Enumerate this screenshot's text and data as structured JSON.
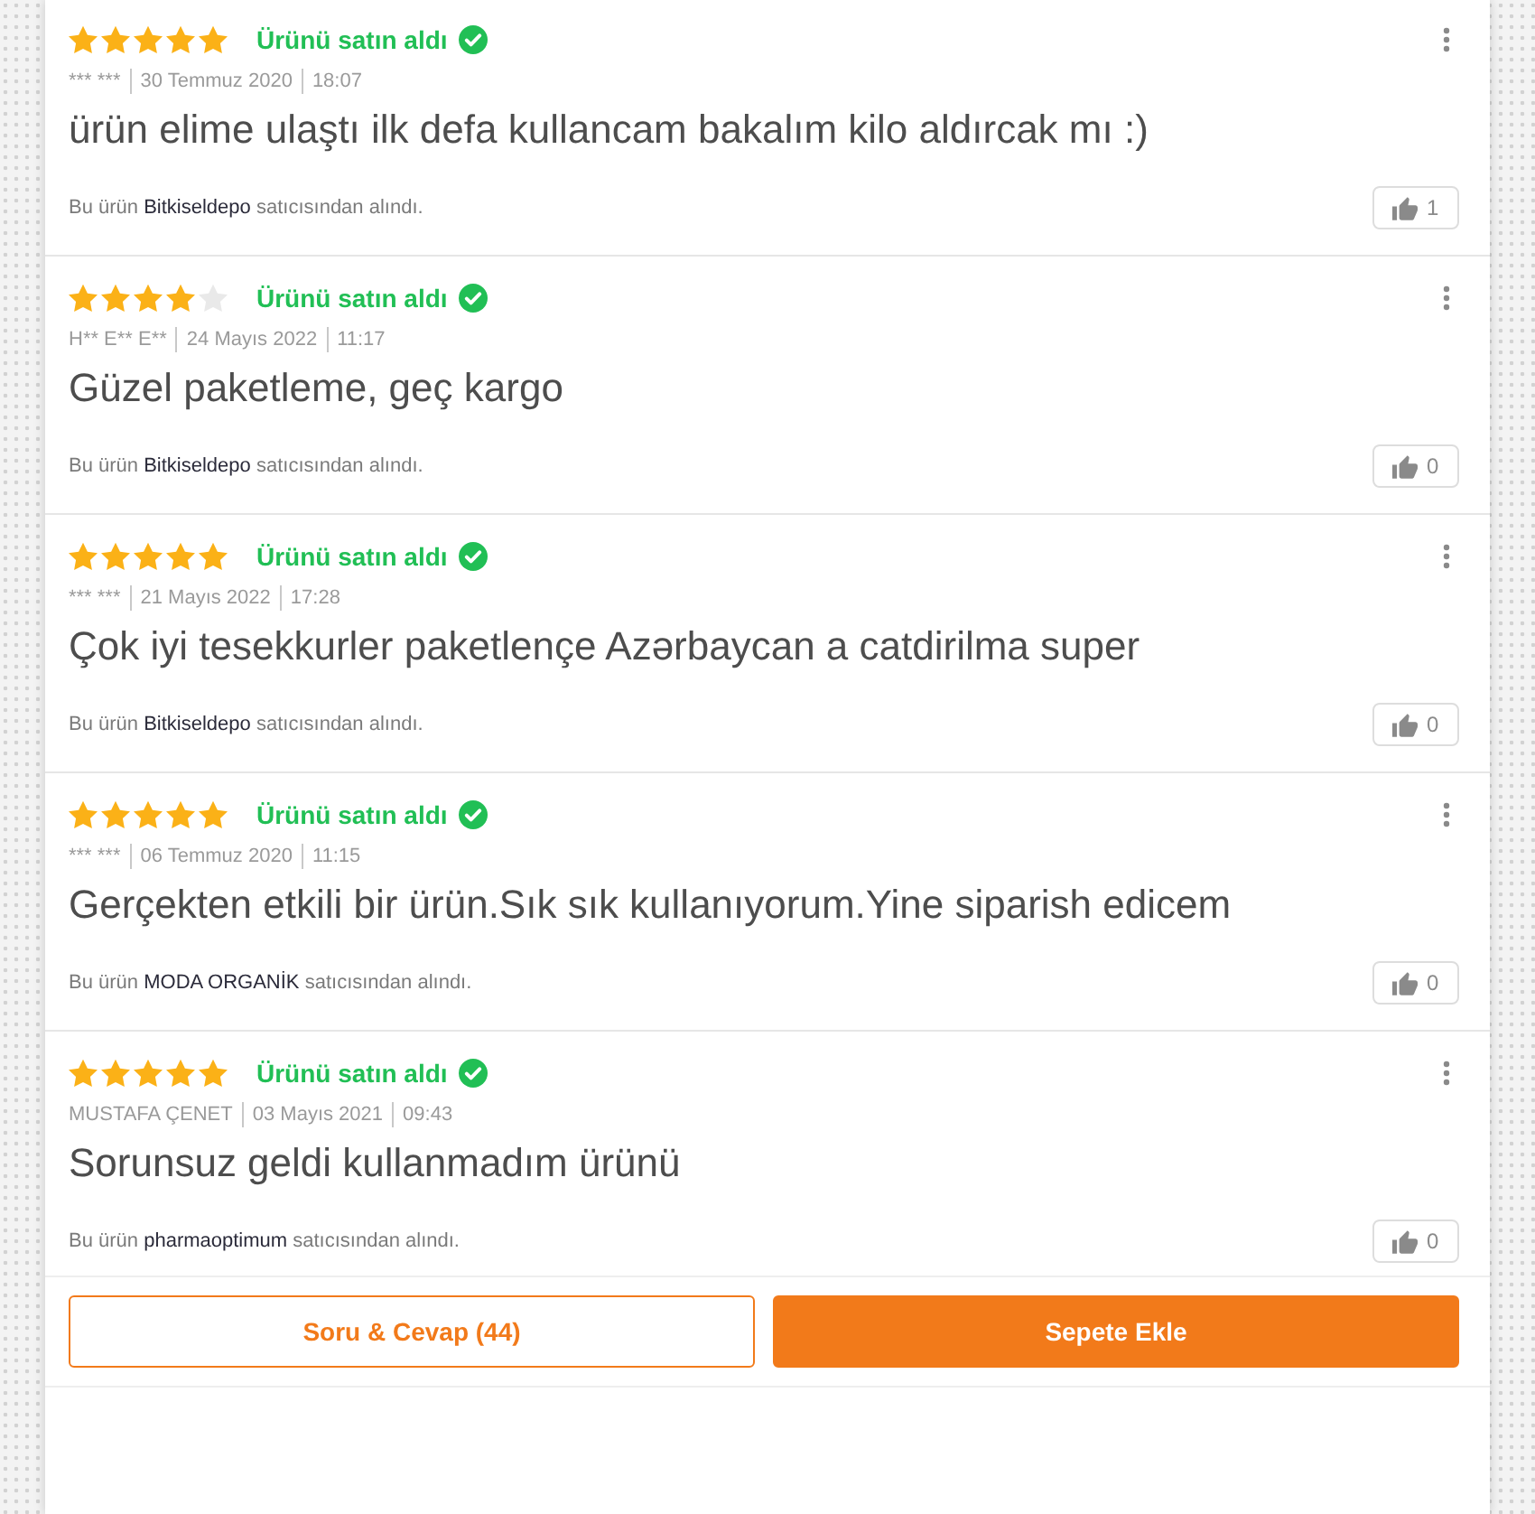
{
  "reviews": [
    {
      "stars": 5,
      "badge": "Ürünü satın aldı",
      "author": "*** ***",
      "date": "30 Temmuz 2020",
      "time": "18:07",
      "comment": "ürün elime ulaştı ilk defa kullancam bakalım kilo aldırcak mı :)",
      "seller_note": {
        "before": "Bu ürün",
        "seller": "Bitkiseldepo",
        "after": "satıcısından alındı."
      },
      "likes": "1"
    },
    {
      "stars": 4,
      "badge": "Ürünü satın aldı",
      "author": "H** E** E**",
      "date": "24 Mayıs 2022",
      "time": "11:17",
      "comment": "Güzel paketleme, geç kargo",
      "seller_note": {
        "before": "Bu ürün",
        "seller": "Bitkiseldepo",
        "after": "satıcısından alındı."
      },
      "likes": "0"
    },
    {
      "stars": 5,
      "badge": "Ürünü satın aldı",
      "author": "*** ***",
      "date": "21 Mayıs 2022",
      "time": "17:28",
      "comment": "Çok iyi tesekkurler paketlençe Azərbaycan a catdirilma super",
      "seller_note": {
        "before": "Bu ürün",
        "seller": "Bitkiseldepo",
        "after": "satıcısından alındı."
      },
      "likes": "0"
    },
    {
      "stars": 5,
      "badge": "Ürünü satın aldı",
      "author": "*** ***",
      "date": "06 Temmuz 2020",
      "time": "11:15",
      "comment": "Gerçekten etkili bir ürün.Sık sık kullanıyorum.Yine siparish edicem",
      "seller_note": {
        "before": "Bu ürün",
        "seller": "MODA ORGANİK",
        "after": "satıcısından alındı."
      },
      "likes": "0"
    },
    {
      "stars": 5,
      "badge": "Ürünü satın aldı",
      "author": "MUSTAFA ÇENET",
      "date": "03 Mayıs 2021",
      "time": "09:43",
      "comment": "Sorunsuz geldi kullanmadım ürünü",
      "seller_note": {
        "before": "Bu ürün",
        "seller": "pharmaoptimum",
        "after": "satıcısından alındı."
      },
      "likes": "0"
    }
  ],
  "actions": [
    {
      "kind": "outline",
      "label": "Soru & Cevap (44)"
    },
    {
      "kind": "primary",
      "label": "Sepete Ekle"
    }
  ]
}
